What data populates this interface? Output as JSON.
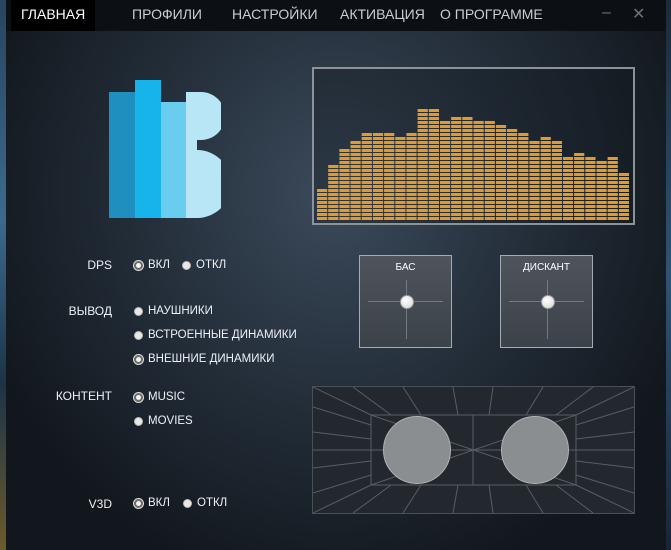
{
  "nav": {
    "tabs": [
      {
        "label": "ГЛАВНАЯ",
        "active": true
      },
      {
        "label": "ПРОФИЛИ",
        "active": false
      },
      {
        "label": "НАСТРОЙКИ",
        "active": false
      },
      {
        "label": "АКТИВАЦИЯ",
        "active": false
      },
      {
        "label": "О ПРОГРАММЕ",
        "active": false
      }
    ],
    "minimize": "–",
    "close": "✕"
  },
  "spectrum": {
    "color": "#e39a2d",
    "levels": [
      0.22,
      0.39,
      0.5,
      0.58,
      0.62,
      0.64,
      0.62,
      0.61,
      0.64,
      0.81,
      0.79,
      0.72,
      0.74,
      0.73,
      0.72,
      0.71,
      0.69,
      0.65,
      0.62,
      0.56,
      0.6,
      0.58,
      0.45,
      0.48,
      0.45,
      0.42,
      0.45,
      0.35
    ]
  },
  "dps": {
    "label": "DPS",
    "on": "ВКЛ",
    "off": "ОТКЛ",
    "selected": "on"
  },
  "output": {
    "label": "ВЫВОД",
    "options": [
      "НАУШНИКИ",
      "ВСТРОЕННЫЕ ДИНАМИКИ",
      "ВНЕШНИЕ ДИНАМИКИ"
    ],
    "selected": 2
  },
  "content": {
    "label": "КОНТЕНТ",
    "options": [
      "MUSIC",
      "MOVIES"
    ],
    "selected": 0
  },
  "v3d": {
    "label": "V3D",
    "on": "ВКЛ",
    "off": "ОТКЛ",
    "selected": "on"
  },
  "bass": {
    "title": "БАС",
    "level": 0.5
  },
  "treble": {
    "title": "ДИСКАНТ",
    "level": 0.5
  }
}
